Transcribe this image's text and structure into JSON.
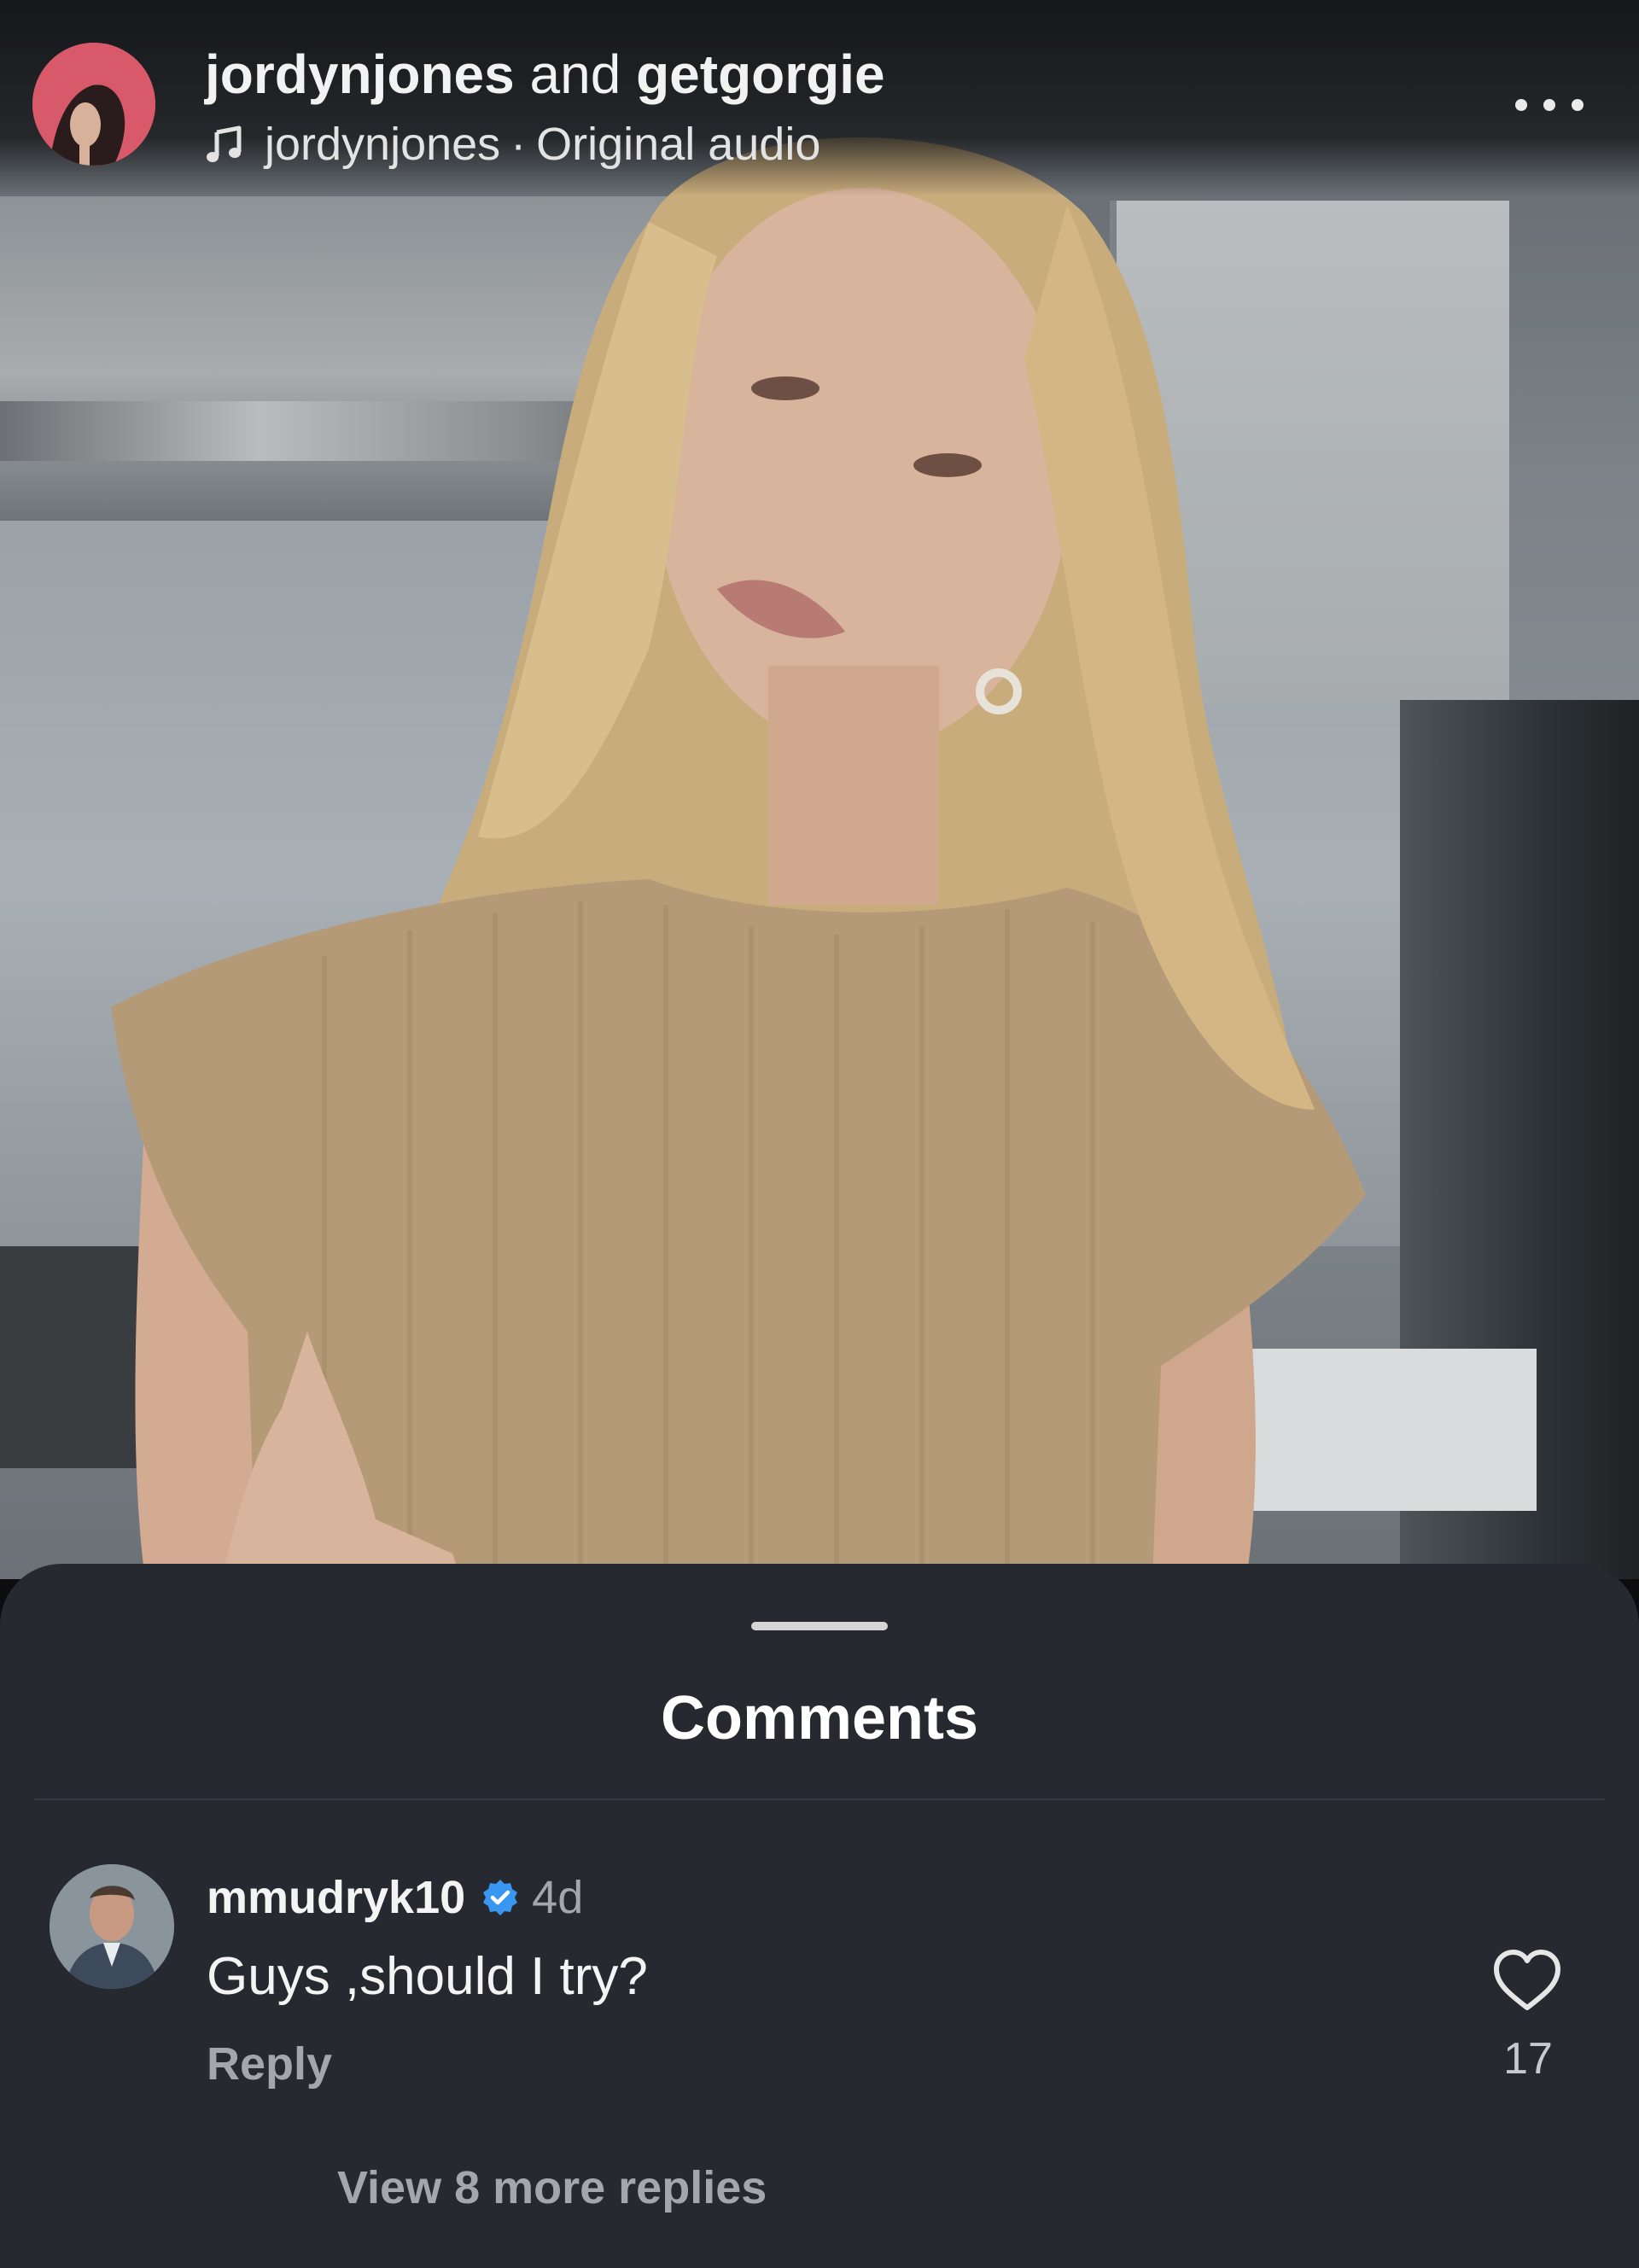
{
  "header": {
    "user_primary": "jordynjones",
    "connector": "and",
    "user_secondary": "getgorgie",
    "audio_user": "jordynjones",
    "audio_separator": "·",
    "audio_label": "Original audio",
    "music_icon": "music-note-icon",
    "more_icon": "more-horizontal-icon"
  },
  "comments_sheet": {
    "title": "Comments",
    "comment": {
      "username": "mmudryk10",
      "verified": true,
      "verified_icon": "verified-badge-icon",
      "verified_color": "#3897f0",
      "time": "4d",
      "text": "Guys ,should I try?",
      "reply_label": "Reply",
      "like_icon": "heart-outline-icon",
      "like_count": "17"
    },
    "view_replies": "View 8 more replies"
  },
  "colors": {
    "sheet_background": "#262a30",
    "secondary_text": "#a3a7ad"
  }
}
